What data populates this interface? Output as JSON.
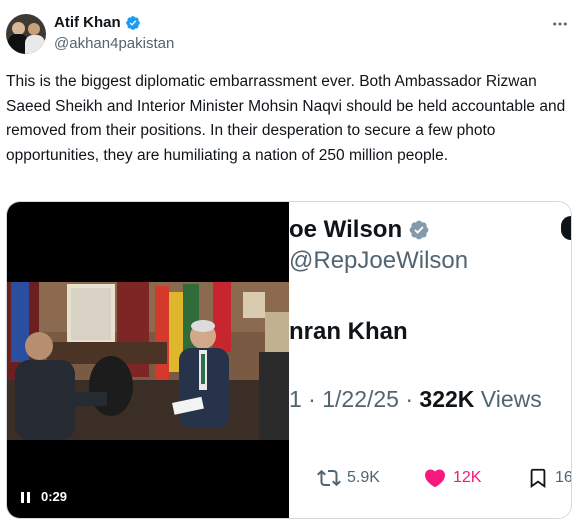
{
  "author": {
    "display_name": "Atif Khan",
    "handle": "@akhan4pakistan",
    "verified": true,
    "verified_color": "#1d9bf0"
  },
  "tweet": {
    "text": "This is the biggest diplomatic embarrassment ever. Both Ambassador Rizwan Saeed Sheikh and Interior Minister Mohsin Naqvi should be held accountable and removed from their positions. In their desperation to secure a few photo opportunities, they are humiliating a nation of 250 million people."
  },
  "media": {
    "video": {
      "time": "0:29",
      "control_icon": "pause-icon"
    },
    "embedded_tweet": {
      "name_visible": "oe Wilson",
      "handle_visible": "@RepJoeWilson",
      "text_visible": "nran Khan",
      "meta_prefix": "1 · 1/22/25 · ",
      "views_count": "322K",
      "views_label": "Views",
      "retweets": "5.9K",
      "likes": "12K",
      "bookmarks": "16"
    }
  },
  "colors": {
    "text_primary": "#0f1419",
    "text_secondary": "#536471",
    "like_pink": "#f91880"
  }
}
